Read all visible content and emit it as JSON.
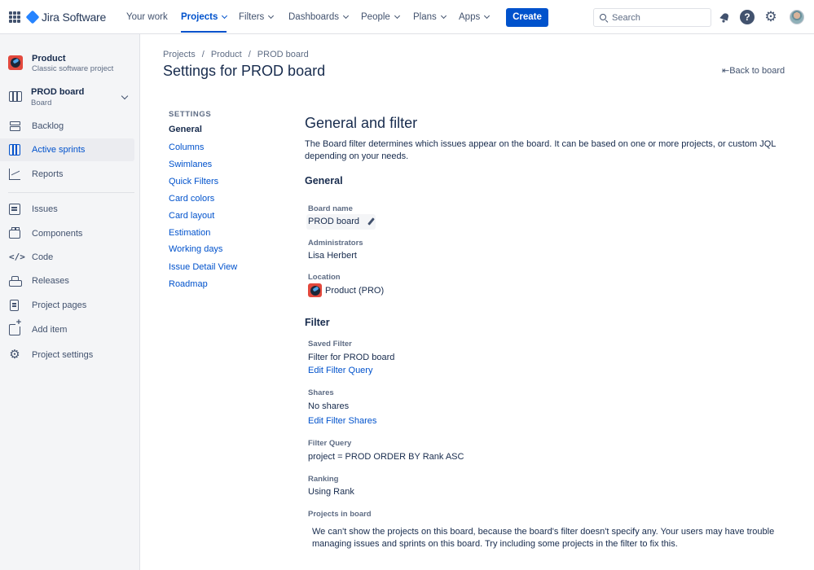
{
  "app": {
    "name": "Jira Software"
  },
  "topnav": {
    "items": [
      {
        "label": "Your work"
      },
      {
        "label": "Projects"
      },
      {
        "label": "Filters"
      },
      {
        "label": "Dashboards"
      },
      {
        "label": "People"
      },
      {
        "label": "Plans"
      },
      {
        "label": "Apps"
      }
    ],
    "create_label": "Create",
    "search_placeholder": "Search",
    "icons": [
      "app-switcher-icon",
      "notification-icon",
      "help-icon",
      "settings-icon",
      "avatar"
    ]
  },
  "sidebar": {
    "project_name": "Product",
    "project_type": "Classic software project",
    "board_name": "PROD board",
    "board_type": "Board",
    "items": [
      {
        "label": "Backlog",
        "icon": "backlog-icon"
      },
      {
        "label": "Active sprints",
        "icon": "board-icon",
        "active": true
      },
      {
        "label": "Reports",
        "icon": "chart-icon"
      },
      {
        "label": "Issues",
        "icon": "issues-icon"
      },
      {
        "label": "Components",
        "icon": "component-icon"
      },
      {
        "label": "Code",
        "icon": "code-icon"
      },
      {
        "label": "Releases",
        "icon": "ship-icon"
      },
      {
        "label": "Project pages",
        "icon": "page-icon"
      },
      {
        "label": "Add item",
        "icon": "add-item-icon"
      },
      {
        "label": "Project settings",
        "icon": "gear-icon"
      }
    ]
  },
  "header": {
    "breadcrumbs": [
      "Projects",
      "/",
      "Product",
      "/",
      "PROD board"
    ],
    "title": "Settings for PROD board",
    "back_link": "Back to board"
  },
  "settings_nav": {
    "heading": "SETTINGS",
    "items": [
      {
        "label": "General",
        "active": true
      },
      {
        "label": "Columns"
      },
      {
        "label": "Swimlanes"
      },
      {
        "label": "Quick Filters"
      },
      {
        "label": "Card colors"
      },
      {
        "label": "Card layout"
      },
      {
        "label": "Estimation"
      },
      {
        "label": "Working days"
      },
      {
        "label": "Issue Detail View"
      },
      {
        "label": "Roadmap"
      }
    ]
  },
  "content": {
    "title": "General and filter",
    "description": "The Board filter determines which issues appear on the board. It can be based on one or more projects, or custom JQL depending on your needs.",
    "general": {
      "heading": "General",
      "board_name_label": "Board name",
      "board_name_value": "PROD board",
      "administrators_label": "Administrators",
      "administrators_value": "Lisa Herbert",
      "location_label": "Location",
      "location_value": "Product (PRO)"
    },
    "filter": {
      "heading": "Filter",
      "saved_filter_label": "Saved Filter",
      "saved_filter_value": "Filter for PROD board",
      "edit_query_link": "Edit Filter Query",
      "shares_label": "Shares",
      "shares_value": "No shares",
      "edit_shares_link": "Edit Filter Shares",
      "query_label": "Filter Query",
      "query_value": "project = PROD ORDER BY Rank ASC",
      "ranking_label": "Ranking",
      "ranking_value": "Using Rank",
      "projects_label": "Projects in board",
      "projects_note": "We can't show the projects on this board, because the board's filter doesn't specify any. Your users may have trouble managing issues and sprints on this board. Try including some projects in the filter to fix this."
    }
  },
  "colors": {
    "brand_blue": "#0052CC",
    "text": "#172B4D",
    "muted": "#5E6C84",
    "sidebar_bg": "#F4F5F7"
  }
}
